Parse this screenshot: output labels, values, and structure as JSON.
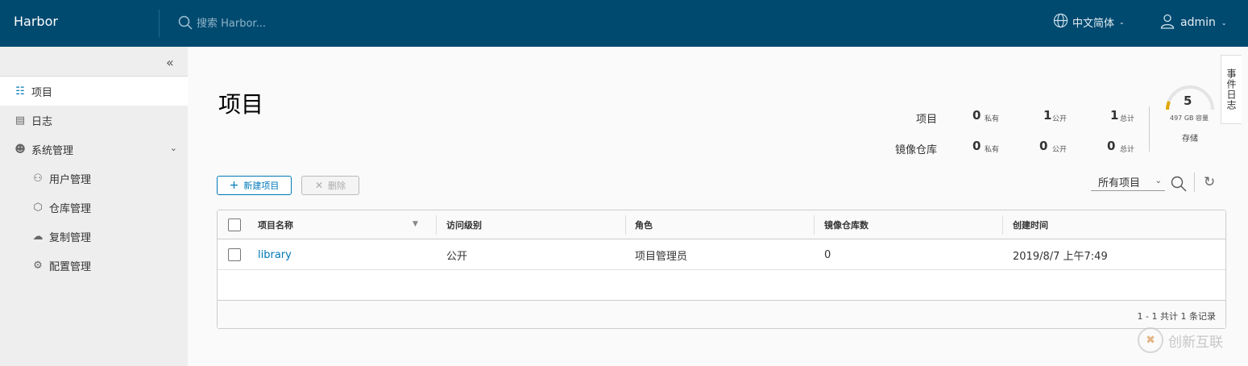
{
  "header": {
    "brand": "Harbor",
    "search_placeholder": "搜索 Harbor...",
    "language": "中文简体",
    "user": "admin",
    "bg_color": "#004a70"
  },
  "sidebar": {
    "items": [
      {
        "label": "项目",
        "icon": "projects-icon",
        "active": true
      },
      {
        "label": "日志",
        "icon": "logs-icon"
      },
      {
        "label": "系统管理",
        "icon": "admin-icon",
        "expandable": true
      },
      {
        "label": "用户管理",
        "icon": "users-icon",
        "sub": true
      },
      {
        "label": "仓库管理",
        "icon": "registry-icon",
        "sub": true
      },
      {
        "label": "复制管理",
        "icon": "replication-icon",
        "sub": true
      },
      {
        "label": "配置管理",
        "icon": "config-icon",
        "sub": true
      }
    ]
  },
  "main": {
    "title": "项目",
    "stats": {
      "project_label": "项目",
      "repo_label": "镜像仓库",
      "project_private": "0",
      "project_public": "1",
      "project_total": "1",
      "repo_private": "0",
      "repo_public": "0",
      "repo_total": "0",
      "unit_private": "私有",
      "unit_public": "公开",
      "unit_total": "总计"
    },
    "storage": {
      "count": "5",
      "capacity": "497 GB 容量",
      "label": "存储"
    },
    "event_log_tab": "事件日志",
    "new_button": "新建项目",
    "delete_button": "删除",
    "filter_value": "所有项目",
    "table": {
      "headers": [
        "项目名称",
        "访问级别",
        "角色",
        "镜像仓库数",
        "创建时间"
      ],
      "rows": [
        {
          "name": "library",
          "access": "公开",
          "role": "项目管理员",
          "repo_count": "0",
          "created": "2019/8/7 上午7:49"
        }
      ],
      "footer": "1 - 1 共计 1 条记录"
    },
    "accent_color": "#0079b8"
  },
  "watermark": {
    "text": "创新互联"
  }
}
